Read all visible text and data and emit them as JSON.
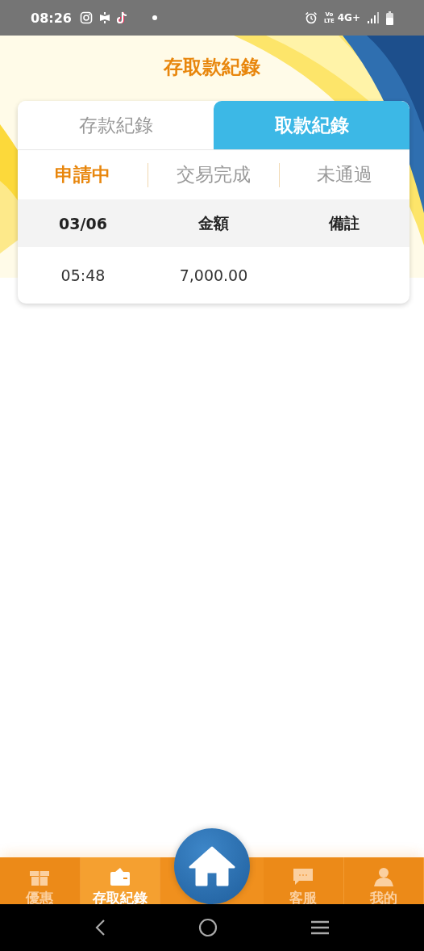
{
  "status_bar": {
    "time": "08:26",
    "volte": [
      "Vo",
      "LTE"
    ],
    "network": "4G+"
  },
  "header": {
    "title": "存取款紀錄"
  },
  "tabs": [
    {
      "label": "存款紀錄",
      "selected": false
    },
    {
      "label": "取款紀錄",
      "selected": true
    }
  ],
  "filters": [
    {
      "label": "申請中",
      "selected": true
    },
    {
      "label": "交易完成",
      "selected": false
    },
    {
      "label": "未通過",
      "selected": false
    }
  ],
  "table": {
    "columns": [
      "03/06",
      "金額",
      "備註"
    ],
    "rows": [
      [
        "05:48",
        "7,000.00",
        ""
      ]
    ]
  },
  "bottom_nav": [
    {
      "label": "優惠",
      "kind": "gift",
      "selected": false
    },
    {
      "label": "存取紀錄",
      "kind": "wallet",
      "selected": true
    },
    {
      "kind": "home"
    },
    {
      "label": "客服",
      "kind": "chat",
      "selected": false
    },
    {
      "label": "我的",
      "kind": "person",
      "selected": false
    }
  ]
}
